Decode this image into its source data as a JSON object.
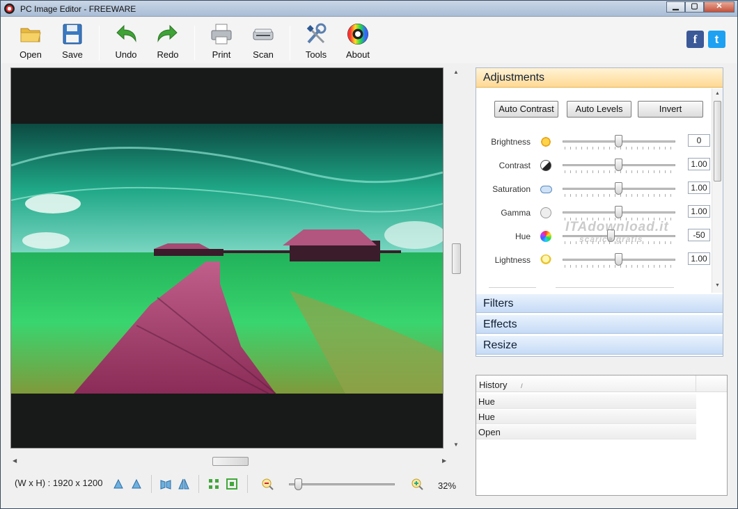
{
  "window": {
    "title": "PC Image Editor - FREEWARE",
    "minimize": "▁",
    "maximize": "▢",
    "close": "✕"
  },
  "toolbar": {
    "items": [
      {
        "label": "Open",
        "icon": "folder-icon"
      },
      {
        "label": "Save",
        "icon": "floppy-icon"
      },
      {
        "label": "Undo",
        "icon": "undo-arrow-icon"
      },
      {
        "label": "Redo",
        "icon": "redo-arrow-icon"
      },
      {
        "label": "Print",
        "icon": "printer-icon"
      },
      {
        "label": "Scan",
        "icon": "scanner-icon"
      },
      {
        "label": "Tools",
        "icon": "wrench-screwdriver-icon"
      },
      {
        "label": "About",
        "icon": "color-wheel-icon"
      }
    ],
    "social": {
      "facebook": "f",
      "twitter": "t"
    }
  },
  "adjustments": {
    "title": "Adjustments",
    "buttons": {
      "auto_contrast": "Auto Contrast",
      "auto_levels": "Auto Levels",
      "invert": "Invert"
    },
    "rows": [
      {
        "label": "Brightness",
        "value": "0",
        "level": 0.5
      },
      {
        "label": "Contrast",
        "value": "1.00",
        "level": 0.5
      },
      {
        "label": "Saturation",
        "value": "1.00",
        "level": 0.5
      },
      {
        "label": "Gamma",
        "value": "1.00",
        "level": 0.5
      },
      {
        "label": "Hue",
        "value": "-50",
        "level": 0.43
      },
      {
        "label": "Lightness",
        "value": "1.00",
        "level": 0.5
      }
    ],
    "watermark": "ITAdownload.it",
    "watermark_sub": "scarica gratis"
  },
  "sections": {
    "filters": "Filters",
    "effects": "Effects",
    "resize": "Resize"
  },
  "history": {
    "header": "History",
    "sort_glyph": "/",
    "items": [
      "Hue",
      "Hue",
      "Open"
    ]
  },
  "status": {
    "dimensions": "(W x H) : 1920 x 1200",
    "zoom": "32%",
    "zoom_level": 0.05
  },
  "colors": {
    "accent": "#ffd993",
    "section": "#c6dbf6",
    "sea": "#2fd97a",
    "sky": "#1ea889",
    "walkway": "#b0406e"
  }
}
